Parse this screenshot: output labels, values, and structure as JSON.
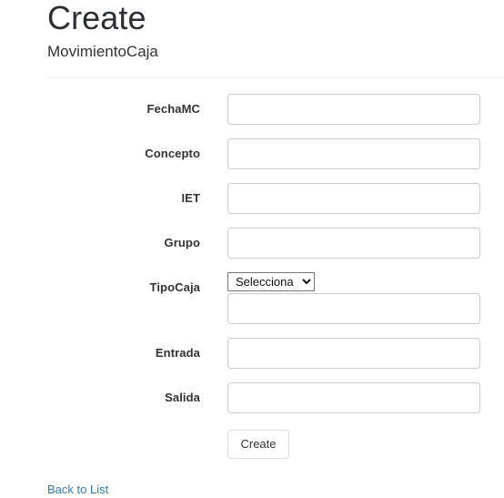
{
  "page": {
    "title": "Create",
    "subtitle": "MovimientoCaja"
  },
  "form": {
    "fields": [
      {
        "label": "FechaMC",
        "type": "text",
        "value": "",
        "placeholder": ""
      },
      {
        "label": "Concepto",
        "type": "text",
        "value": "",
        "placeholder": ""
      },
      {
        "label": "IET",
        "type": "text",
        "value": "",
        "placeholder": ""
      },
      {
        "label": "Grupo",
        "type": "text",
        "value": "",
        "placeholder": ""
      },
      {
        "label": "TipoCaja",
        "type": "select-with-text",
        "selected_option": "Selecciona",
        "options": [
          "Selecciona"
        ],
        "value": "",
        "placeholder": ""
      },
      {
        "label": "Entrada",
        "type": "text",
        "value": "",
        "placeholder": ""
      },
      {
        "label": "Salida",
        "type": "text",
        "value": "",
        "placeholder": ""
      }
    ],
    "submit_label": "Create"
  },
  "footer": {
    "back_link_label": "Back to List"
  },
  "icons": {
    "select_chevron": "chevron-down-icon"
  },
  "colors": {
    "link": "#337ab7",
    "text": "#333333",
    "input_border": "#cccccc",
    "divider": "#eeeeee",
    "button_border": "#dddddd"
  }
}
